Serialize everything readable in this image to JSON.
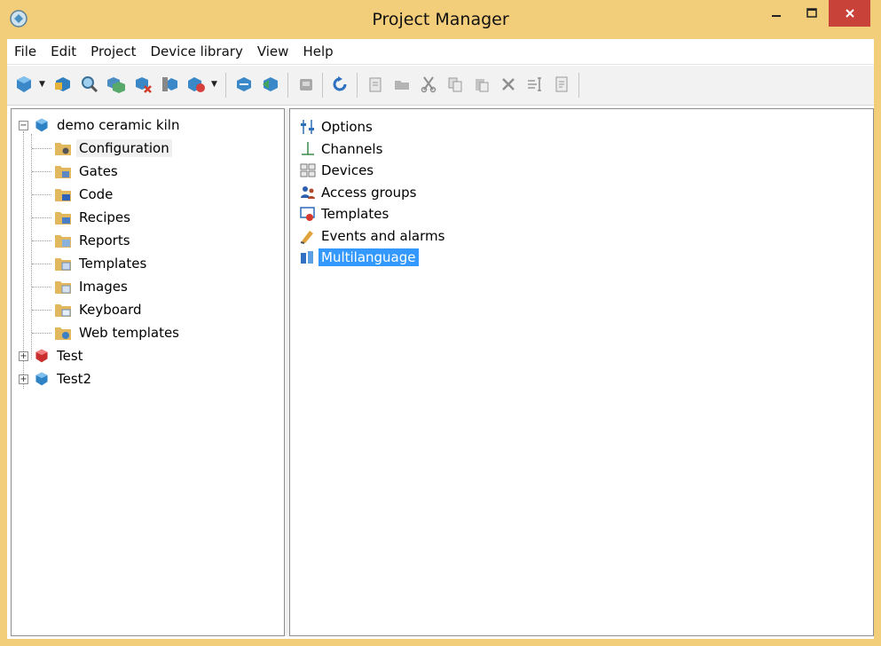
{
  "window": {
    "title": "Project Manager"
  },
  "menu": [
    "File",
    "Edit",
    "Project",
    "Device library",
    "View",
    "Help"
  ],
  "tree": {
    "root": {
      "label": "demo ceramic kiln",
      "children": [
        "Configuration",
        "Gates",
        "Code",
        "Recipes",
        "Reports",
        "Templates",
        "Images",
        "Keyboard",
        "Web templates"
      ]
    },
    "others": [
      "Test",
      "Test2"
    ]
  },
  "list": [
    "Options",
    "Channels",
    "Devices",
    "Access groups",
    "Templates",
    "Events and alarms",
    "Multilanguage"
  ],
  "selection": {
    "tree_item": "Configuration",
    "list_item": "Multilanguage"
  },
  "colors": {
    "titlebar": "#f3ce7a",
    "close": "#c9423a",
    "selection": "#3399ff"
  }
}
